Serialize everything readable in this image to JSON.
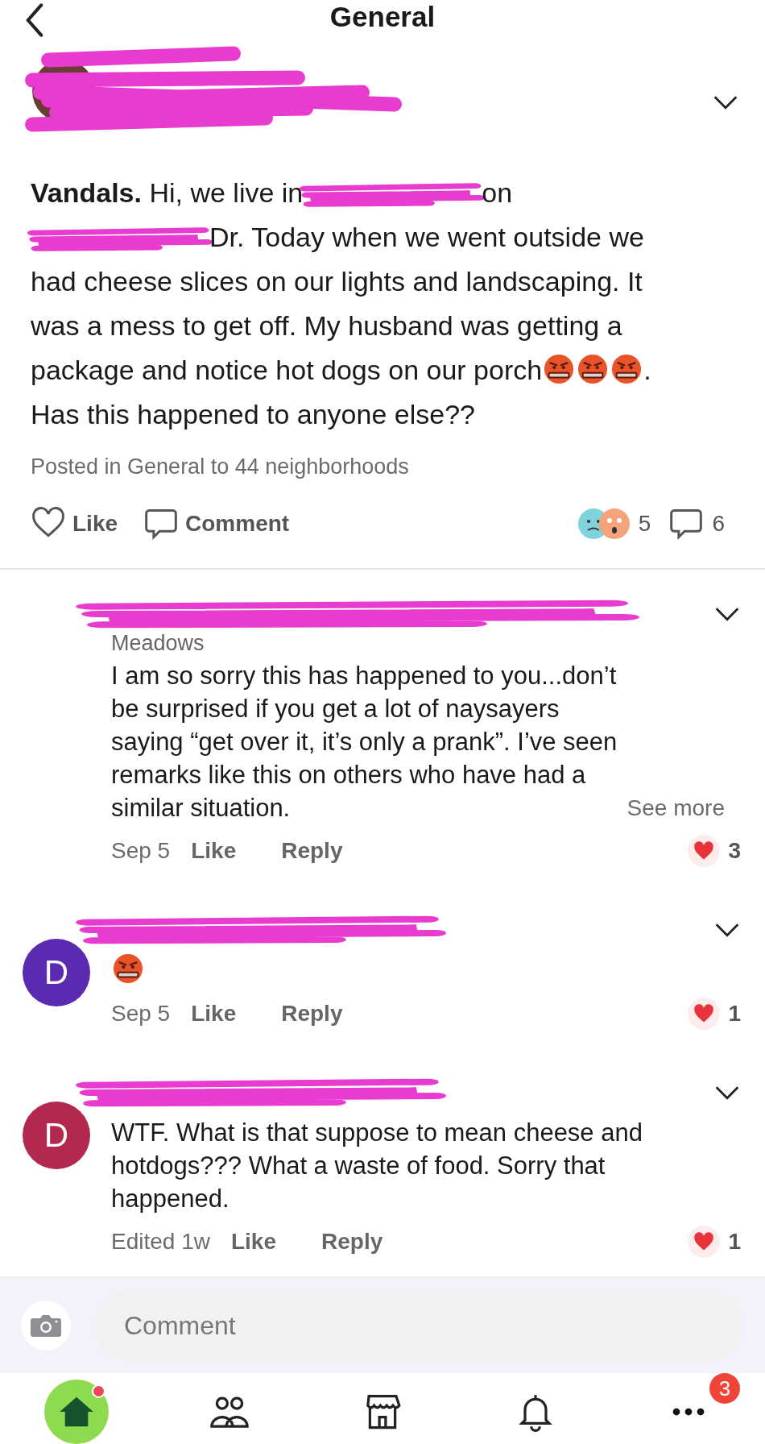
{
  "header": {
    "title": "General"
  },
  "post": {
    "body": [
      {
        "kind": "text",
        "text": "**Vandals.** Hi, we live in"
      },
      {
        "kind": "redacted"
      },
      {
        "kind": "text",
        "text": "on"
      },
      {
        "kind": "redacted"
      },
      {
        "kind": "text",
        "text": "Dr.   Today when we went outside we had cheese slices on our lights and landscaping. It was a mess to get off.  My husband was getting a package and notice hot dogs on our porch"
      },
      {
        "kind": "emoji"
      },
      {
        "kind": "emoji"
      },
      {
        "kind": "emoji"
      },
      {
        "kind": "text",
        "text": ".  Has this happened to anyone else??"
      }
    ],
    "posted_in": "Posted in General to 44 neighborhoods",
    "actions": [
      {
        "kind": "like",
        "label": "Like"
      },
      {
        "kind": "comment",
        "label": "Comment"
      }
    ],
    "reaction_count": "5",
    "comment_count": "6"
  },
  "comments": [
    {
      "neighborhood": "Meadows",
      "body": [
        {
          "kind": "text",
          "text": "I am so sorry this has happened to you...don’t be surprised if you get a lot of naysayers saying “get over it, it’s only a prank”. I’ve seen remarks like this on others who have had a similar situation."
        }
      ],
      "see_more": "See more",
      "time": "Sep 5",
      "like": "Like",
      "reply": "Reply",
      "likes": "3"
    },
    {
      "avatar_letter": "D",
      "color": "#5a2bb0",
      "body": [
        {
          "kind": "emoji"
        }
      ],
      "time": "Sep 5",
      "like": "Like",
      "reply": "Reply",
      "likes": "1"
    },
    {
      "avatar_letter": "D",
      "color": "#b3284f",
      "body": [
        {
          "kind": "text",
          "text": "WTF. What is that suppose to mean cheese and hotdogs??? What a waste of food. Sorry that happened."
        }
      ],
      "time": "Edited 1w",
      "like": "Like",
      "reply": "Reply",
      "likes": "1"
    }
  ],
  "composer": {
    "placeholder": "Comment"
  },
  "nav": [
    {
      "kind": "home",
      "selected": true,
      "dot": true
    },
    {
      "kind": "neighbors",
      "selected": false
    },
    {
      "kind": "shop",
      "selected": false
    },
    {
      "kind": "bell",
      "selected": false
    },
    {
      "kind": "more",
      "selected": false,
      "badge": "3"
    }
  ]
}
